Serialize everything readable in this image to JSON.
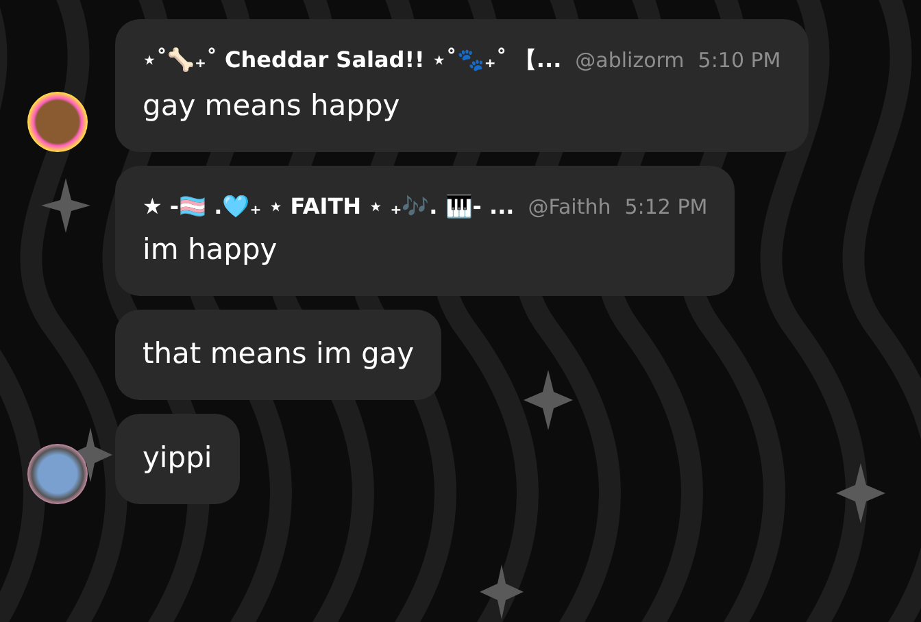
{
  "messages": [
    {
      "avatar": true,
      "author": "⋆˚🦴₊˚ Cheddar Salad!! ⋆˚🐾₊˚ 【...",
      "handle": "@ablizorm",
      "time": "5:10 PM",
      "text": "gay means happy"
    },
    {
      "avatar": false,
      "author": "★ -🏳️‍⚧️ .🩵₊ ⋆ FAITH ⋆ ₊🎶. 🎹- ...",
      "handle": "@Faithh",
      "time": "5:12 PM",
      "text": "im happy"
    },
    {
      "avatar": false,
      "text": "that means im gay"
    },
    {
      "avatar": true,
      "text": "yippi"
    }
  ]
}
